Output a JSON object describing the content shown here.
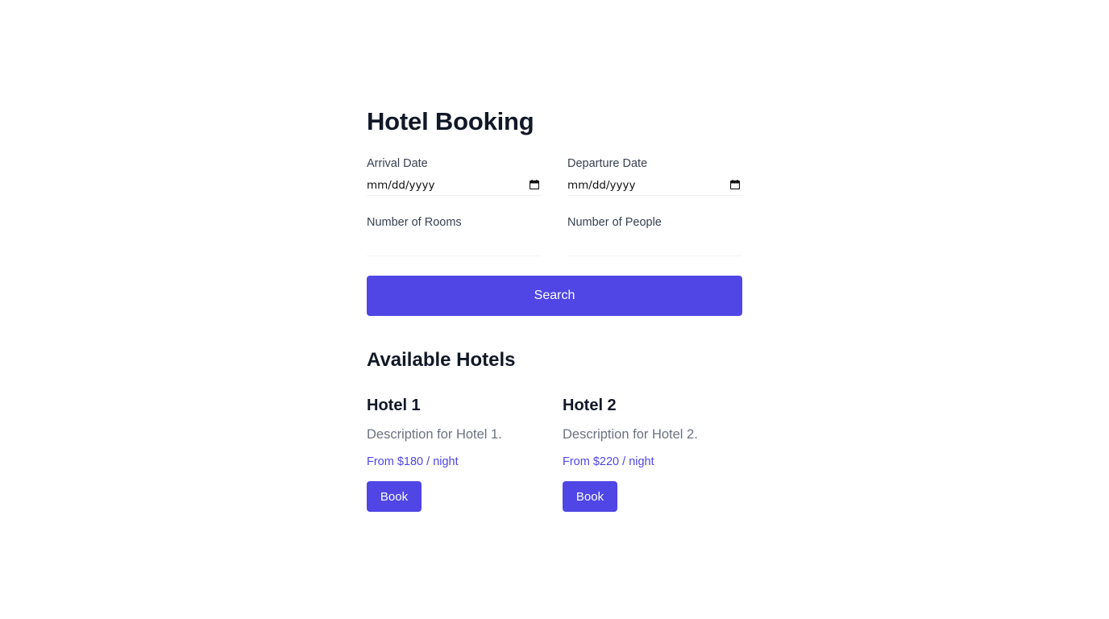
{
  "page": {
    "title": "Hotel Booking"
  },
  "form": {
    "arrival": {
      "label": "Arrival Date",
      "value": "mm/dd/yyyy"
    },
    "departure": {
      "label": "Departure Date",
      "value": "mm/dd/yyyy"
    },
    "rooms": {
      "label": "Number of Rooms",
      "value": ""
    },
    "people": {
      "label": "Number of People",
      "value": ""
    },
    "search_label": "Search",
    "calendar_icon": "calendar-icon"
  },
  "results": {
    "title": "Available Hotels",
    "hotels": [
      {
        "name": "Hotel 1",
        "description": "Description for Hotel 1.",
        "price": "From $180 / night",
        "book_label": "Book"
      },
      {
        "name": "Hotel 2",
        "description": "Description for Hotel 2.",
        "price": "From $220 / night",
        "book_label": "Book"
      }
    ]
  },
  "colors": {
    "accent": "#4f46e5",
    "heading": "#111827",
    "label": "#374151",
    "muted": "#6b7280"
  }
}
